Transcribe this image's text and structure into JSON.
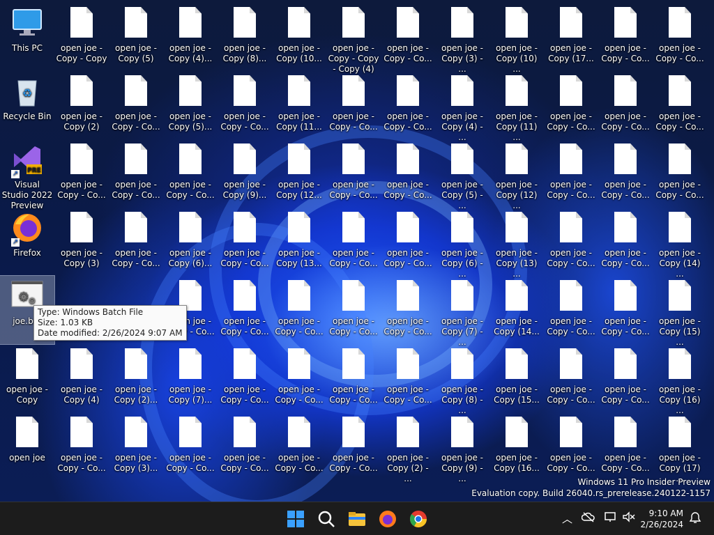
{
  "desktop": {
    "icons": [
      {
        "label": "This PC",
        "type": "pc",
        "col": 0,
        "row": 0
      },
      {
        "label": "Recycle Bin",
        "type": "bin",
        "col": 0,
        "row": 1
      },
      {
        "label": "Visual Studio 2022 Preview",
        "type": "vs",
        "col": 0,
        "row": 2
      },
      {
        "label": "Firefox",
        "type": "firefox",
        "col": 0,
        "row": 3
      },
      {
        "label": "joe.bat",
        "type": "bat",
        "col": 0,
        "row": 4,
        "selected": true
      },
      {
        "label": "open joe - Copy",
        "type": "doc",
        "col": 0,
        "row": 5
      },
      {
        "label": "open joe",
        "type": "doc",
        "col": 0,
        "row": 6
      },
      {
        "label": "open joe - Copy - Copy",
        "type": "doc",
        "col": 1,
        "row": 0
      },
      {
        "label": "open joe - Copy (2)",
        "type": "doc",
        "col": 1,
        "row": 1
      },
      {
        "label": "open joe - Copy - Co...",
        "type": "doc",
        "col": 1,
        "row": 2
      },
      {
        "label": "open joe - Copy (3)",
        "type": "doc",
        "col": 1,
        "row": 3
      },
      {
        "label": "open joe - Copy (4)",
        "type": "doc",
        "col": 1,
        "row": 5
      },
      {
        "label": "open joe - Copy - Co...",
        "type": "doc",
        "col": 1,
        "row": 6
      },
      {
        "label": "open joe - Copy (5)",
        "type": "doc",
        "col": 2,
        "row": 0
      },
      {
        "label": "open joe - Copy - Co...",
        "type": "doc",
        "col": 2,
        "row": 1
      },
      {
        "label": "open joe - Copy - Co...",
        "type": "doc",
        "col": 2,
        "row": 2
      },
      {
        "label": "open joe - Copy - Co...",
        "type": "doc",
        "col": 2,
        "row": 3
      },
      {
        "label": "open joe - Copy (2)...",
        "type": "doc",
        "col": 2,
        "row": 5
      },
      {
        "label": "open joe - Copy (3)...",
        "type": "doc",
        "col": 2,
        "row": 6
      },
      {
        "label": "open joe - Copy (4)...",
        "type": "doc",
        "col": 3,
        "row": 0
      },
      {
        "label": "open joe - Copy (5)...",
        "type": "doc",
        "col": 3,
        "row": 1
      },
      {
        "label": "open joe - Copy - Co...",
        "type": "doc",
        "col": 3,
        "row": 2
      },
      {
        "label": "open joe - Copy (6)...",
        "type": "doc",
        "col": 3,
        "row": 3
      },
      {
        "label": "open joe - Copy - Co...",
        "type": "doc",
        "col": 3,
        "row": 4
      },
      {
        "label": "open joe - Copy (7)...",
        "type": "doc",
        "col": 3,
        "row": 5
      },
      {
        "label": "open joe - Copy - Co...",
        "type": "doc",
        "col": 3,
        "row": 6
      },
      {
        "label": "open joe - Copy (8)...",
        "type": "doc",
        "col": 4,
        "row": 0
      },
      {
        "label": "open joe - Copy - Co...",
        "type": "doc",
        "col": 4,
        "row": 1
      },
      {
        "label": "open joe - Copy (9)...",
        "type": "doc",
        "col": 4,
        "row": 2
      },
      {
        "label": "open joe - Copy - Co...",
        "type": "doc",
        "col": 4,
        "row": 3
      },
      {
        "label": "open joe - Copy - Co...",
        "type": "doc",
        "col": 4,
        "row": 4
      },
      {
        "label": "open joe - Copy - Co...",
        "type": "doc",
        "col": 4,
        "row": 5
      },
      {
        "label": "open joe - Copy - Co...",
        "type": "doc",
        "col": 4,
        "row": 6
      },
      {
        "label": "open joe - Copy (10...",
        "type": "doc",
        "col": 5,
        "row": 0
      },
      {
        "label": "open joe - Copy (11...",
        "type": "doc",
        "col": 5,
        "row": 1
      },
      {
        "label": "open joe - Copy (12...",
        "type": "doc",
        "col": 5,
        "row": 2
      },
      {
        "label": "open joe - Copy (13...",
        "type": "doc",
        "col": 5,
        "row": 3
      },
      {
        "label": "open joe - Copy - Co...",
        "type": "doc",
        "col": 5,
        "row": 4
      },
      {
        "label": "open joe - Copy - Co...",
        "type": "doc",
        "col": 5,
        "row": 5
      },
      {
        "label": "open joe - Copy - Co...",
        "type": "doc",
        "col": 5,
        "row": 6
      },
      {
        "label": "open joe - Copy - Copy - Copy (4)",
        "type": "doc",
        "col": 6,
        "row": 0
      },
      {
        "label": "open joe - Copy - Co...",
        "type": "doc",
        "col": 6,
        "row": 1
      },
      {
        "label": "open joe - Copy - Co...",
        "type": "doc",
        "col": 6,
        "row": 2
      },
      {
        "label": "open joe - Copy - Co...",
        "type": "doc",
        "col": 6,
        "row": 3
      },
      {
        "label": "open joe - Copy - Co...",
        "type": "doc",
        "col": 6,
        "row": 4
      },
      {
        "label": "open joe - Copy - Co...",
        "type": "doc",
        "col": 6,
        "row": 5
      },
      {
        "label": "open joe - Copy - Co...",
        "type": "doc",
        "col": 6,
        "row": 6
      },
      {
        "label": "open joe - Copy - Co...",
        "type": "doc",
        "col": 7,
        "row": 0
      },
      {
        "label": "open joe - Copy - Co...",
        "type": "doc",
        "col": 7,
        "row": 1
      },
      {
        "label": "open joe - Copy - Co...",
        "type": "doc",
        "col": 7,
        "row": 2
      },
      {
        "label": "open joe - Copy - Co...",
        "type": "doc",
        "col": 7,
        "row": 3
      },
      {
        "label": "open joe - Copy - Co...",
        "type": "doc",
        "col": 7,
        "row": 4
      },
      {
        "label": "open joe - Copy - Co...",
        "type": "doc",
        "col": 7,
        "row": 5
      },
      {
        "label": "open joe - Copy (2) - ...",
        "type": "doc",
        "col": 7,
        "row": 6
      },
      {
        "label": "open joe - Copy (3) - ...",
        "type": "doc",
        "col": 8,
        "row": 0
      },
      {
        "label": "open joe - Copy (4) - ...",
        "type": "doc",
        "col": 8,
        "row": 1
      },
      {
        "label": "open joe - Copy (5) - ...",
        "type": "doc",
        "col": 8,
        "row": 2
      },
      {
        "label": "open joe - Copy (6) - ...",
        "type": "doc",
        "col": 8,
        "row": 3
      },
      {
        "label": "open joe - Copy (7) - ...",
        "type": "doc",
        "col": 8,
        "row": 4
      },
      {
        "label": "open joe - Copy (8) - ...",
        "type": "doc",
        "col": 8,
        "row": 5
      },
      {
        "label": "open joe - Copy (9) - ...",
        "type": "doc",
        "col": 8,
        "row": 6
      },
      {
        "label": "open joe - Copy (10) ...",
        "type": "doc",
        "col": 9,
        "row": 0
      },
      {
        "label": "open joe - Copy (11) ...",
        "type": "doc",
        "col": 9,
        "row": 1
      },
      {
        "label": "open joe - Copy (12) ...",
        "type": "doc",
        "col": 9,
        "row": 2
      },
      {
        "label": "open joe - Copy (13) ...",
        "type": "doc",
        "col": 9,
        "row": 3
      },
      {
        "label": "open joe - Copy (14...",
        "type": "doc",
        "col": 9,
        "row": 4
      },
      {
        "label": "open joe - Copy (15...",
        "type": "doc",
        "col": 9,
        "row": 5
      },
      {
        "label": "open joe - Copy (16...",
        "type": "doc",
        "col": 9,
        "row": 6
      },
      {
        "label": "open joe - Copy (17...",
        "type": "doc",
        "col": 10,
        "row": 0
      },
      {
        "label": "open joe - Copy - Co...",
        "type": "doc",
        "col": 10,
        "row": 1
      },
      {
        "label": "open joe - Copy - Co...",
        "type": "doc",
        "col": 10,
        "row": 2
      },
      {
        "label": "open joe - Copy - Co...",
        "type": "doc",
        "col": 10,
        "row": 3
      },
      {
        "label": "open joe - Copy - Co...",
        "type": "doc",
        "col": 10,
        "row": 4
      },
      {
        "label": "open joe - Copy - Co...",
        "type": "doc",
        "col": 10,
        "row": 5
      },
      {
        "label": "open joe - Copy - Co...",
        "type": "doc",
        "col": 10,
        "row": 6
      },
      {
        "label": "open joe - Copy - Co...",
        "type": "doc",
        "col": 11,
        "row": 0
      },
      {
        "label": "open joe - Copy - Co...",
        "type": "doc",
        "col": 11,
        "row": 1
      },
      {
        "label": "open joe - Copy - Co...",
        "type": "doc",
        "col": 11,
        "row": 2
      },
      {
        "label": "open joe - Copy - Co...",
        "type": "doc",
        "col": 11,
        "row": 3
      },
      {
        "label": "open joe - Copy - Co...",
        "type": "doc",
        "col": 11,
        "row": 4
      },
      {
        "label": "open joe - Copy - Co...",
        "type": "doc",
        "col": 11,
        "row": 5
      },
      {
        "label": "open joe - Copy - Co...",
        "type": "doc",
        "col": 11,
        "row": 6
      },
      {
        "label": "open joe - Copy - Co...",
        "type": "doc",
        "col": 12,
        "row": 0
      },
      {
        "label": "open joe - Copy - Co...",
        "type": "doc",
        "col": 12,
        "row": 1
      },
      {
        "label": "open joe - Copy - Co...",
        "type": "doc",
        "col": 12,
        "row": 2
      },
      {
        "label": "open joe - Copy (14) ...",
        "type": "doc",
        "col": 12,
        "row": 3
      },
      {
        "label": "open joe - Copy (15) ...",
        "type": "doc",
        "col": 12,
        "row": 4
      },
      {
        "label": "open joe - Copy (16) ...",
        "type": "doc",
        "col": 12,
        "row": 5
      },
      {
        "label": "open joe - Copy (17) ...",
        "type": "doc",
        "col": 12,
        "row": 6
      }
    ],
    "vs_badge": "PRE"
  },
  "tooltip": {
    "type": "Type: Windows Batch File",
    "size": "Size: 1.03 KB",
    "date": "Date modified: 2/26/2024 9:07 AM"
  },
  "watermark": {
    "line1": "Windows 11 Pro Insider Preview",
    "line2": "Evaluation copy. Build 26040.rs_prerelease.240122-1157"
  },
  "taskbar": {
    "apps": [
      "start-icon",
      "search-icon",
      "file-explorer-icon",
      "firefox-icon",
      "chrome-icon"
    ],
    "tray": [
      "chevron-up-icon",
      "onedrive-icon",
      "network-icon",
      "volume-muted-icon"
    ],
    "time": "9:10 AM",
    "date": "2/26/2024"
  },
  "colors": {
    "accent": "#2f6bff",
    "taskbar": "#1c1c1c"
  }
}
